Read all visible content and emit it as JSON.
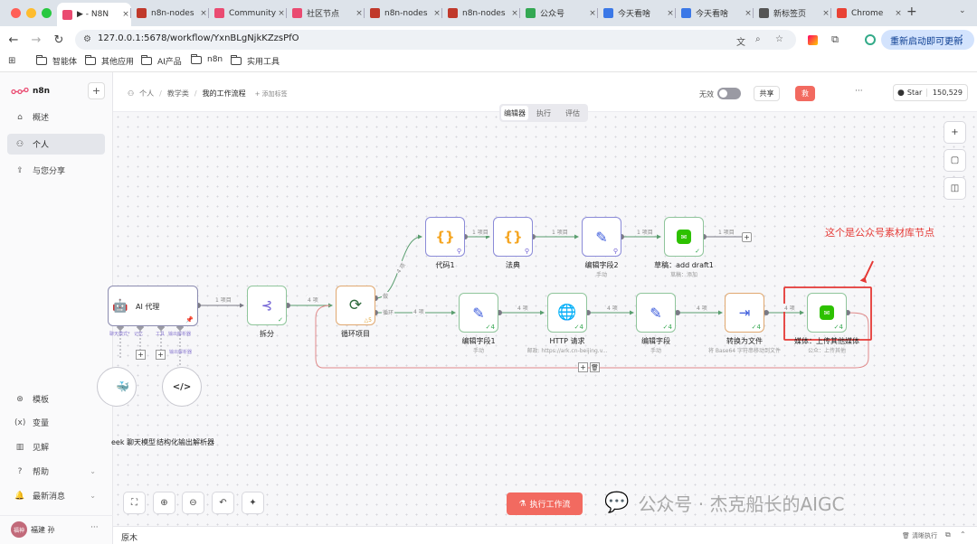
{
  "browser": {
    "tabs": [
      {
        "title": "▶ - N8N",
        "icon": "n8n-icon",
        "color": "#ea4b71"
      },
      {
        "title": "n8n-nodes",
        "icon": "notion-icon",
        "color": "#c0392b"
      },
      {
        "title": "Community",
        "icon": "n8n-icon",
        "color": "#ea4b71"
      },
      {
        "title": "社区节点",
        "icon": "n8n-icon",
        "color": "#ea4b71"
      },
      {
        "title": "n8n-nodes",
        "icon": "notion-icon",
        "color": "#c0392b"
      },
      {
        "title": "n8n-nodes",
        "icon": "notion-icon",
        "color": "#c0392b"
      },
      {
        "title": "公众号",
        "icon": "recycle-icon",
        "color": "#34a853"
      },
      {
        "title": "今天看啥",
        "icon": "doc-icon",
        "color": "#3b78e7"
      },
      {
        "title": "今天看啥",
        "icon": "doc-icon",
        "color": "#3b78e7"
      },
      {
        "title": "新标签页",
        "icon": "chrome-icon",
        "color": "#555555"
      },
      {
        "title": "Chrome",
        "icon": "chrome-icon",
        "color": "#e94235"
      }
    ],
    "url": "127.0.0.1:5678/workflow/YxnBLgNjkKZzsPfO",
    "update_button": "重新启动即可更新",
    "bookmarks": [
      "智能体",
      "其他应用",
      "AI产品",
      "n8n",
      "实用工具"
    ]
  },
  "sidebar": {
    "logo": "n8n",
    "add": "+",
    "items": [
      {
        "label": "概述",
        "icon": "home-icon"
      },
      {
        "label": "个人",
        "icon": "user-icon"
      },
      {
        "label": "与您分享",
        "icon": "share-icon"
      }
    ],
    "bottom_items": [
      {
        "label": "模板",
        "icon": "template-icon"
      },
      {
        "label": "变量",
        "icon": "variable-icon"
      },
      {
        "label": "见解",
        "icon": "chart-icon"
      },
      {
        "label": "帮助",
        "icon": "help-icon"
      },
      {
        "label": "最新消息",
        "icon": "bell-icon"
      }
    ],
    "user": {
      "avatar": "福神",
      "name": "福建 孙",
      "more": "···"
    }
  },
  "header": {
    "breadcrumb": [
      "个人",
      "教学类",
      "我的工作流程"
    ],
    "add_tag": "+ 添加标签",
    "active_label": "无效",
    "share": "共享",
    "save": "救",
    "more": "···",
    "github_star": "Star",
    "star_count": "150,529",
    "tabs": [
      "编辑器",
      "执行",
      "评估"
    ]
  },
  "canvas": {
    "annotation": "这个是公众号素材库节点",
    "nodes": {
      "ai_agent": {
        "label": "AI 代理"
      },
      "split": {
        "label": "拆分"
      },
      "loop": {
        "label": "循环项目",
        "badge": "5"
      },
      "code1": {
        "label": "代码1"
      },
      "code_fa": {
        "label": "法典"
      },
      "edit2": {
        "label": "编辑字段2",
        "sub": "手动"
      },
      "draft": {
        "label": "草稿：add draft1",
        "sub": "草稿：添加"
      },
      "edit1": {
        "label": "编辑字段1",
        "sub": "手动"
      },
      "http": {
        "label": "HTTP 请求",
        "sub": "邮政: https://ark.cn-beijing.v..."
      },
      "edit": {
        "label": "编辑字段",
        "sub": "手动"
      },
      "convert": {
        "label": "转换为文件",
        "sub": "将 Base64 字符串移动到文件"
      },
      "media": {
        "label": "媒体：上传其他媒体",
        "sub": "公众：上传其他"
      },
      "chat_model": {
        "label": "eek 聊天模型"
      },
      "parser": {
        "label": "结构化输出解析器"
      }
    },
    "agent_ports": [
      "聊天模式*",
      "记忆",
      "工具",
      "输出解析器"
    ],
    "parser_port": "输出解析器",
    "edges": {
      "agent_split": "1 项目",
      "split_loop": "4 项",
      "loop_done": "4 项",
      "loop_code": "4 项",
      "done": "做",
      "loop": "循环",
      "code_fa": "1 项目",
      "fa_edit2": "1 项目",
      "edit2_draft": "1 项目",
      "draft_out": "1 项目",
      "edit1_http": "4 项",
      "http_edit": "4 项",
      "edit_convert": "4 项",
      "convert_media": "4 项"
    },
    "counts": {
      "four": "4"
    },
    "run_button": "执行工作流",
    "watermark": "公众号 · 杰克船长的AIGC"
  },
  "logbar": {
    "left": "原木",
    "clear": "清晰执行"
  }
}
